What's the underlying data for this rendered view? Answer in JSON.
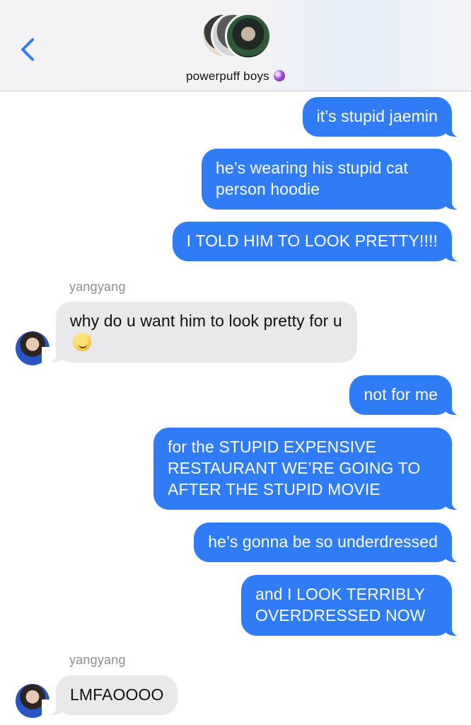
{
  "header": {
    "group_name": "powerpuff boys"
  },
  "messages": [
    {
      "from": "me",
      "text": "it’s stupid jaemin"
    },
    {
      "from": "me",
      "text": "he’s wearing his stupid cat person hoodie"
    },
    {
      "from": "me",
      "text": "I TOLD HIM TO LOOK PRETTY!!!!"
    },
    {
      "from": "yangyang",
      "sender": "yangyang",
      "text": "why do u want him to look pretty for u"
    },
    {
      "from": "me",
      "text": "not for me"
    },
    {
      "from": "me",
      "text": "for the STUPID EXPENSIVE RESTAURANT WE’RE GOING TO AFTER THE STUPID MOVIE"
    },
    {
      "from": "me",
      "text": "he’s gonna be so underdressed"
    },
    {
      "from": "me",
      "text": "and I LOOK TERRIBLY OVERDRESSED NOW"
    },
    {
      "from": "yangyang",
      "sender": "yangyang",
      "text": "LMFAOOOO"
    }
  ],
  "icons": {
    "back": "chevron-left-icon",
    "group_emoji": "crystal-ball-icon",
    "message_emoji": "smirk-emoji-icon"
  },
  "colors": {
    "outgoing_bubble": "#2f7cf6",
    "incoming_bubble": "#e9e9eb",
    "accent": "#2f7cf6"
  }
}
